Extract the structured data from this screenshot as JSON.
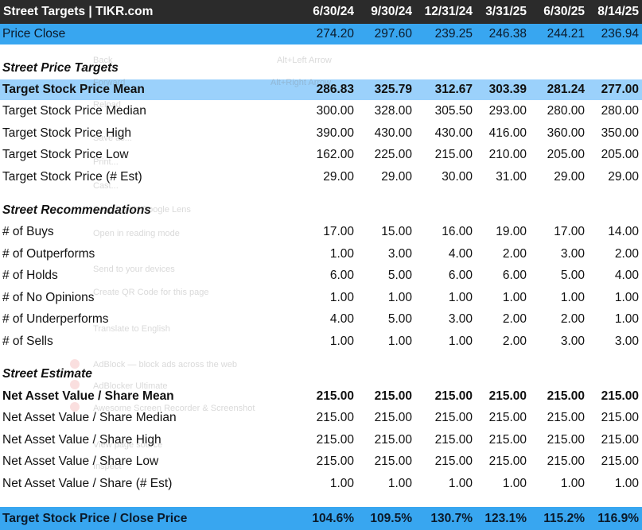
{
  "header": {
    "title": "Street Targets | TIKR.com",
    "dates": [
      "6/30/24",
      "9/30/24",
      "12/31/24",
      "3/31/25",
      "6/30/25",
      "8/14/25"
    ]
  },
  "price_close": {
    "label": "Price Close",
    "values": [
      "274.20",
      "297.60",
      "239.25",
      "246.38",
      "244.21",
      "236.94"
    ]
  },
  "sections": {
    "targets": "Street Price Targets",
    "recommendations": "Street Recommendations",
    "estimate": "Street Estimate"
  },
  "targets": [
    {
      "label": "Target Stock Price Mean",
      "values": [
        "286.83",
        "325.79",
        "312.67",
        "303.39",
        "281.24",
        "277.00"
      ]
    },
    {
      "label": "Target Stock Price Median",
      "values": [
        "300.00",
        "328.00",
        "305.50",
        "293.00",
        "280.00",
        "280.00"
      ]
    },
    {
      "label": "Target Stock Price High",
      "values": [
        "390.00",
        "430.00",
        "430.00",
        "416.00",
        "360.00",
        "350.00"
      ]
    },
    {
      "label": "Target Stock Price Low",
      "values": [
        "162.00",
        "225.00",
        "215.00",
        "210.00",
        "205.00",
        "205.00"
      ]
    },
    {
      "label": "Target Stock Price (# Est)",
      "values": [
        "29.00",
        "29.00",
        "30.00",
        "31.00",
        "29.00",
        "29.00"
      ]
    }
  ],
  "recommendations": [
    {
      "label": "# of Buys",
      "values": [
        "17.00",
        "15.00",
        "16.00",
        "19.00",
        "17.00",
        "14.00"
      ]
    },
    {
      "label": "# of Outperforms",
      "values": [
        "1.00",
        "3.00",
        "4.00",
        "2.00",
        "3.00",
        "2.00"
      ]
    },
    {
      "label": "# of Holds",
      "values": [
        "6.00",
        "5.00",
        "6.00",
        "6.00",
        "5.00",
        "4.00"
      ]
    },
    {
      "label": "# of No Opinions",
      "values": [
        "1.00",
        "1.00",
        "1.00",
        "1.00",
        "1.00",
        "1.00"
      ]
    },
    {
      "label": "# of Underperforms",
      "values": [
        "4.00",
        "5.00",
        "3.00",
        "2.00",
        "2.00",
        "1.00"
      ]
    },
    {
      "label": "# of Sells",
      "values": [
        "1.00",
        "1.00",
        "1.00",
        "2.00",
        "3.00",
        "3.00"
      ]
    }
  ],
  "estimate": [
    {
      "label": "Net Asset Value / Share Mean",
      "values": [
        "215.00",
        "215.00",
        "215.00",
        "215.00",
        "215.00",
        "215.00"
      ]
    },
    {
      "label": "Net Asset Value / Share Median",
      "values": [
        "215.00",
        "215.00",
        "215.00",
        "215.00",
        "215.00",
        "215.00"
      ]
    },
    {
      "label": "Net Asset Value / Share High",
      "values": [
        "215.00",
        "215.00",
        "215.00",
        "215.00",
        "215.00",
        "215.00"
      ]
    },
    {
      "label": "Net Asset Value / Share Low",
      "values": [
        "215.00",
        "215.00",
        "215.00",
        "215.00",
        "215.00",
        "215.00"
      ]
    },
    {
      "label": "Net Asset Value / Share (# Est)",
      "values": [
        "1.00",
        "1.00",
        "1.00",
        "1.00",
        "1.00",
        "1.00"
      ]
    }
  ],
  "footer": {
    "label": "Target Stock Price / Close Price",
    "values": [
      "104.6%",
      "109.5%",
      "130.7%",
      "123.1%",
      "115.2%",
      "116.9%"
    ]
  },
  "ghost_menu": {
    "items": [
      "Back",
      "Forward",
      "Reload",
      "Save as...",
      "Print...",
      "Cast...",
      "Search with Google Lens",
      "Open in reading mode",
      "Send to your devices",
      "Create QR Code for this page",
      "Translate to English",
      "AdBlock — block ads across the web",
      "AdBlocker Ultimate",
      "Awesome Screen Recorder & Screenshot",
      "View page source",
      "Inspect"
    ],
    "shortcuts": [
      "Alt+Left Arrow",
      "Alt+Right Arrow"
    ]
  }
}
